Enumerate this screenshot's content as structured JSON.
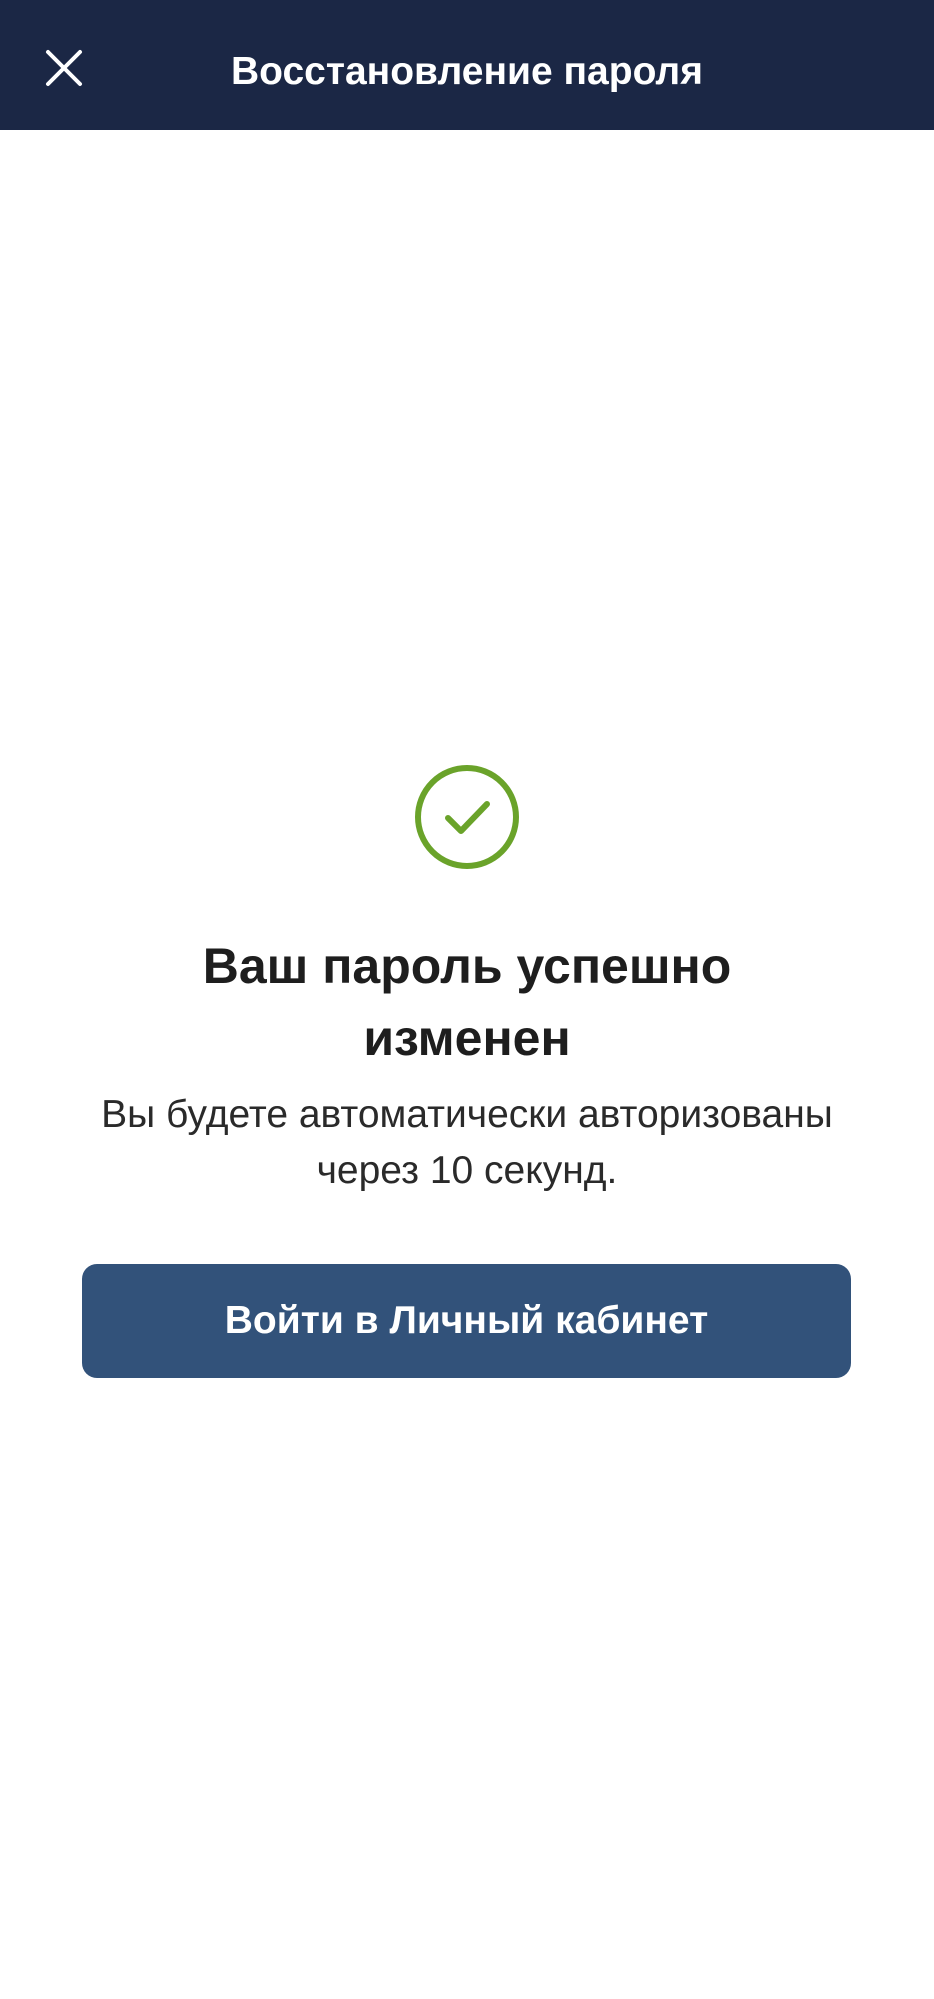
{
  "header": {
    "title": "Восстановление пароля",
    "close_icon": "close-icon",
    "background": "#1b2745"
  },
  "result": {
    "icon": "check-circle-icon",
    "icon_color": "#6aa32a",
    "headline": "Ваш пароль успешно изменен",
    "message": "Вы будете автоматически авторизованы через 10 секунд."
  },
  "actions": {
    "login_label": "Войти в Личный кабинет",
    "button_color": "#32527a"
  }
}
